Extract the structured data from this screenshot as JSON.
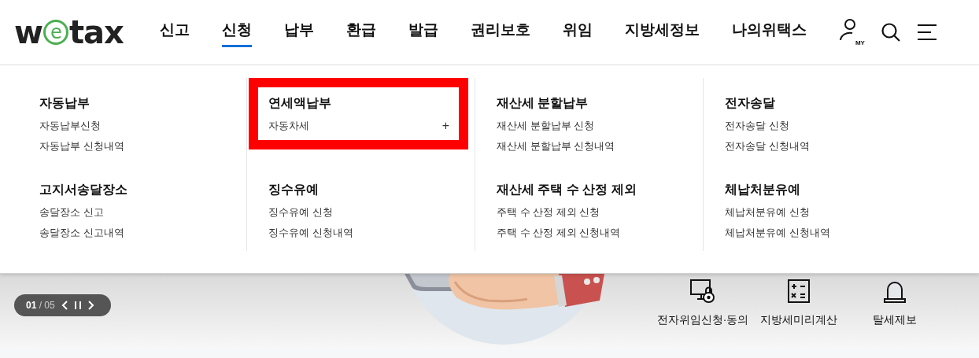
{
  "logo": {
    "parts": [
      "w",
      "e",
      "tax"
    ]
  },
  "nav": [
    {
      "label": "신고",
      "selected": false
    },
    {
      "label": "신청",
      "selected": true
    },
    {
      "label": "납부",
      "selected": false
    },
    {
      "label": "환급",
      "selected": false
    },
    {
      "label": "발급",
      "selected": false
    },
    {
      "label": "권리보호",
      "selected": false
    },
    {
      "label": "위임",
      "selected": false
    },
    {
      "label": "지방세정보",
      "selected": false
    },
    {
      "label": "나의위택스",
      "selected": false
    }
  ],
  "header_icons": {
    "my_label": "MY"
  },
  "menu_columns": [
    {
      "groups": [
        {
          "title": "자동납부",
          "highlighted": false,
          "items": [
            {
              "label": "자동납부신청"
            },
            {
              "label": "자동납부 신청내역"
            }
          ]
        },
        {
          "title": "고지서송달장소",
          "highlighted": false,
          "items": [
            {
              "label": "송달장소 신고"
            },
            {
              "label": "송달장소 신고내역"
            }
          ]
        }
      ]
    },
    {
      "groups": [
        {
          "title": "연세액납부",
          "highlighted": true,
          "items": [
            {
              "label": "자동차세",
              "toggle": "+"
            }
          ]
        },
        {
          "title": "징수유예",
          "highlighted": false,
          "items": [
            {
              "label": "징수유예 신청"
            },
            {
              "label": "징수유예 신청내역"
            }
          ]
        }
      ]
    },
    {
      "groups": [
        {
          "title": "재산세 분할납부",
          "highlighted": false,
          "items": [
            {
              "label": "재산세 분할납부 신청"
            },
            {
              "label": "재산세 분할납부 신청내역"
            }
          ]
        },
        {
          "title": "재산세 주택 수 산정 제외",
          "highlighted": false,
          "items": [
            {
              "label": "주택 수 산정 제외 신청"
            },
            {
              "label": "주택 수 산정 제외 신청내역"
            }
          ]
        }
      ]
    },
    {
      "groups": [
        {
          "title": "전자송달",
          "highlighted": false,
          "items": [
            {
              "label": "전자송달 신청"
            },
            {
              "label": "전자송달 신청내역"
            }
          ]
        },
        {
          "title": "체납처분유예",
          "highlighted": false,
          "items": [
            {
              "label": "체납처분유예 신청"
            },
            {
              "label": "체납처분유예 신청내역"
            }
          ]
        }
      ]
    }
  ],
  "pager": {
    "current": "01",
    "total": "/ 05"
  },
  "quick_links": [
    {
      "kind": "monitor-lock",
      "label": "전자위임신청·동의"
    },
    {
      "kind": "calculator",
      "label": "지방세미리계산"
    },
    {
      "kind": "siren",
      "label": "탈세제보"
    }
  ]
}
